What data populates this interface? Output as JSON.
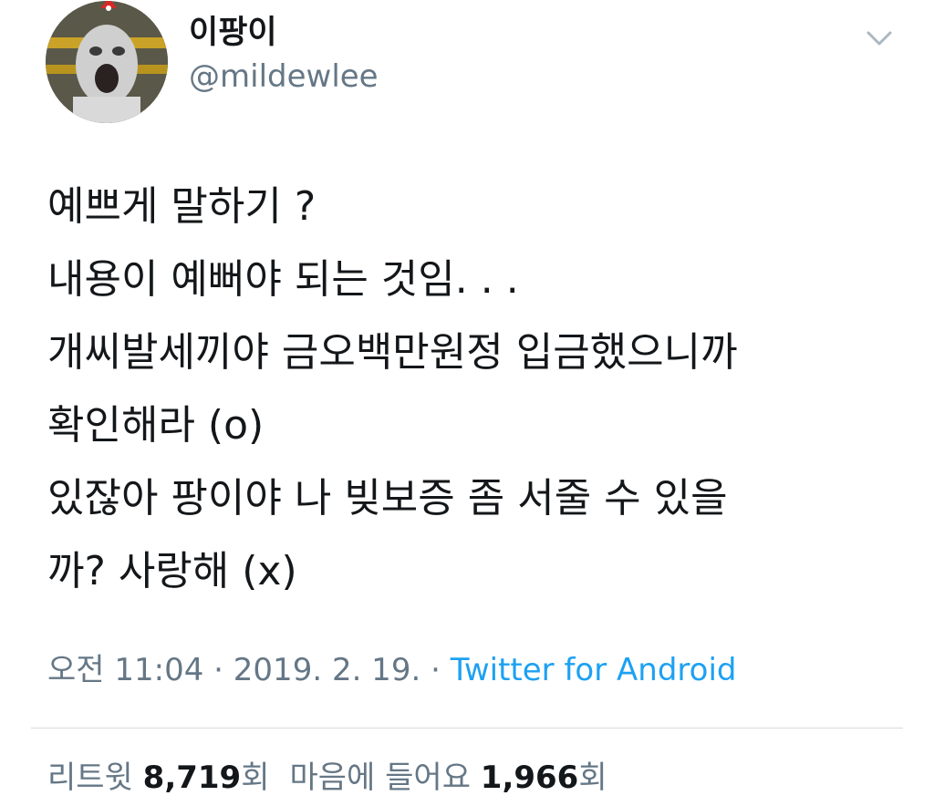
{
  "user": {
    "display_name": "이팡이",
    "handle": "@mildewlee",
    "avatar": "avatar-photo"
  },
  "menu": {
    "icon": "chevron-down-icon"
  },
  "tweet": {
    "lines": [
      "예쁘게 말하기 ?",
      "내용이 예뻐야 되는 것임. . .",
      "개씨발세끼야 금오백만원정 입금했으니까",
      "확인해라 (o)",
      "있잖아 팡이야 나 빚보증 좀 서줄 수 있을",
      "까? 사랑해 (x)"
    ]
  },
  "meta": {
    "time": "오전 11:04",
    "separator1": " · ",
    "date": "2019. 2. 19.",
    "separator2": " · ",
    "source": "Twitter for Android"
  },
  "stats": {
    "retweets_label": "리트윗 ",
    "retweets_count": "8,719",
    "retweets_suffix": "회",
    "likes_label": "마음에 들어요 ",
    "likes_count": "1,966",
    "likes_suffix": "회"
  },
  "colors": {
    "text_primary": "#14171a",
    "text_secondary": "#657786",
    "link": "#1da1f2",
    "divider": "#d6dbe0"
  }
}
